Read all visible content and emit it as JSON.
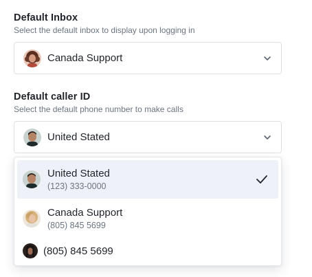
{
  "default_inbox": {
    "title": "Default Inbox",
    "description": "Select the default inbox to display upon logging in",
    "selected_label": "Canada Support",
    "avatar_icon": "avatar-woman-curly-hair",
    "chevron_icon": "chevron-down-icon"
  },
  "default_caller_id": {
    "title": "Default caller ID",
    "description": "Select the default phone number to make calls",
    "selected_label": "United Stated",
    "avatar_icon": "avatar-man",
    "chevron_icon": "chevron-down-icon",
    "options": [
      {
        "title": "United Stated",
        "subtitle": "(123) 333-0000",
        "selected": true,
        "avatar_icon": "avatar-man"
      },
      {
        "title": "Canada Support",
        "subtitle": "(805) 845 5699",
        "selected": false,
        "avatar_icon": "avatar-woman-blonde"
      },
      {
        "title": "(805) 845 5699",
        "selected": false,
        "avatar_icon": "avatar-dark-hair"
      }
    ],
    "check_icon": "checkmark-icon"
  },
  "colors": {
    "text_primary": "#1f2329",
    "text_secondary": "#6b7480",
    "border": "#dde1e6",
    "selected_bg": "#eef1f7"
  }
}
